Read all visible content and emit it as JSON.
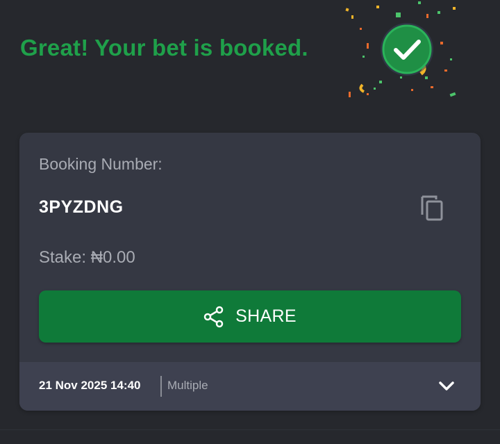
{
  "header": {
    "headline": "Great! Your bet is booked.",
    "success_icon": "check-circle-icon",
    "accent_color": "#1fa04a"
  },
  "booking": {
    "label": "Booking Number:",
    "code": "3PYZDNG",
    "copy_icon": "copy-icon",
    "stake_text": "Stake: ₦0.00"
  },
  "share": {
    "label": "SHARE",
    "icon": "share-icon",
    "button_color": "#0f7a39"
  },
  "footer": {
    "datetime": "21 Nov 2025 14:40",
    "bet_type": "Multiple",
    "expand_icon": "chevron-down-icon"
  }
}
